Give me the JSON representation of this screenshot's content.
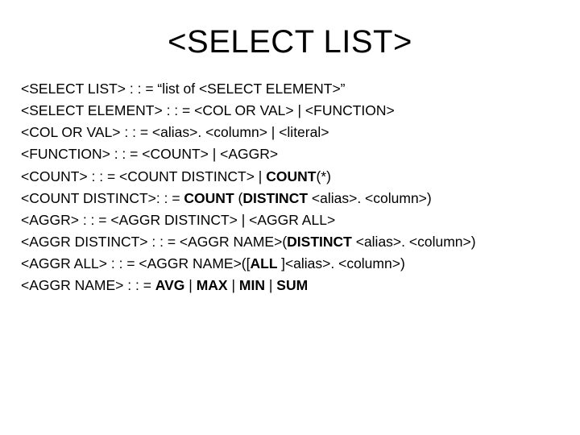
{
  "title": "<SELECT LIST>",
  "rules": [
    {
      "segments": [
        {
          "t": "<SELECT LIST> : : = “list of <SELECT ELEMENT>”"
        }
      ]
    },
    {
      "segments": [
        {
          "t": "<SELECT ELEMENT> : : = <COL OR VAL> | <FUNCTION>"
        }
      ]
    },
    {
      "segments": [
        {
          "t": "<COL OR VAL> : : = <alias>. <column> | <literal>"
        }
      ]
    },
    {
      "segments": [
        {
          "t": "<FUNCTION> : : = <COUNT> | <AGGR>"
        }
      ]
    },
    {
      "segments": [
        {
          "t": "<COUNT> : : = <COUNT DISTINCT> | "
        },
        {
          "t": "COUNT",
          "b": true
        },
        {
          "t": "(*)"
        }
      ]
    },
    {
      "segments": [
        {
          "t": "<COUNT DISTINCT>: : = "
        },
        {
          "t": "COUNT ",
          "b": true
        },
        {
          "t": "("
        },
        {
          "t": "DISTINCT ",
          "b": true
        },
        {
          "t": "<alias>. <column>)"
        }
      ]
    },
    {
      "segments": [
        {
          "t": "<AGGR> : : = <AGGR DISTINCT> | <AGGR ALL>"
        }
      ]
    },
    {
      "segments": [
        {
          "t": "<AGGR DISTINCT> : : = <AGGR NAME>("
        },
        {
          "t": "DISTINCT ",
          "b": true
        },
        {
          "t": "<alias>. <column>)"
        }
      ]
    },
    {
      "segments": [
        {
          "t": "<AGGR ALL> : : = <AGGR NAME>(["
        },
        {
          "t": "ALL ",
          "b": true
        },
        {
          "t": "]<alias>. <column>)"
        }
      ]
    },
    {
      "segments": [
        {
          "t": "<AGGR NAME> : : = "
        },
        {
          "t": "AVG ",
          "b": true
        },
        {
          "t": "| "
        },
        {
          "t": "MAX ",
          "b": true
        },
        {
          "t": "| "
        },
        {
          "t": "MIN ",
          "b": true
        },
        {
          "t": "| "
        },
        {
          "t": "SUM",
          "b": true
        }
      ]
    }
  ]
}
